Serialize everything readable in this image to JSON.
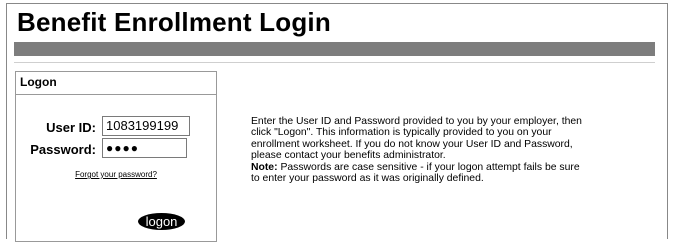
{
  "page": {
    "title": "Benefit Enrollment Login"
  },
  "logon": {
    "header": "Logon",
    "user_id_label": "User ID:",
    "user_id_value": "1083199199",
    "password_label": "Password:",
    "password_mask": "●●●●",
    "forgot_link": "Forgot your password?",
    "button_label": "logon"
  },
  "instructions": {
    "lines": [
      "Enter the User ID and Password provided to you by your employer, then",
      "click \"Logon\". This information is typically provided to you on your",
      "enrollment worksheet. If you do not know your User ID and Password,",
      "please contact your benefits administrator."
    ],
    "note_label": "Note:",
    "note_line1": " Passwords are case sensitive - if your logon attempt fails be sure",
    "note_line2": "to enter your password as it was originally defined."
  },
  "colors": {
    "title_bar": "#7d7d7d",
    "button_bg": "#000000"
  }
}
